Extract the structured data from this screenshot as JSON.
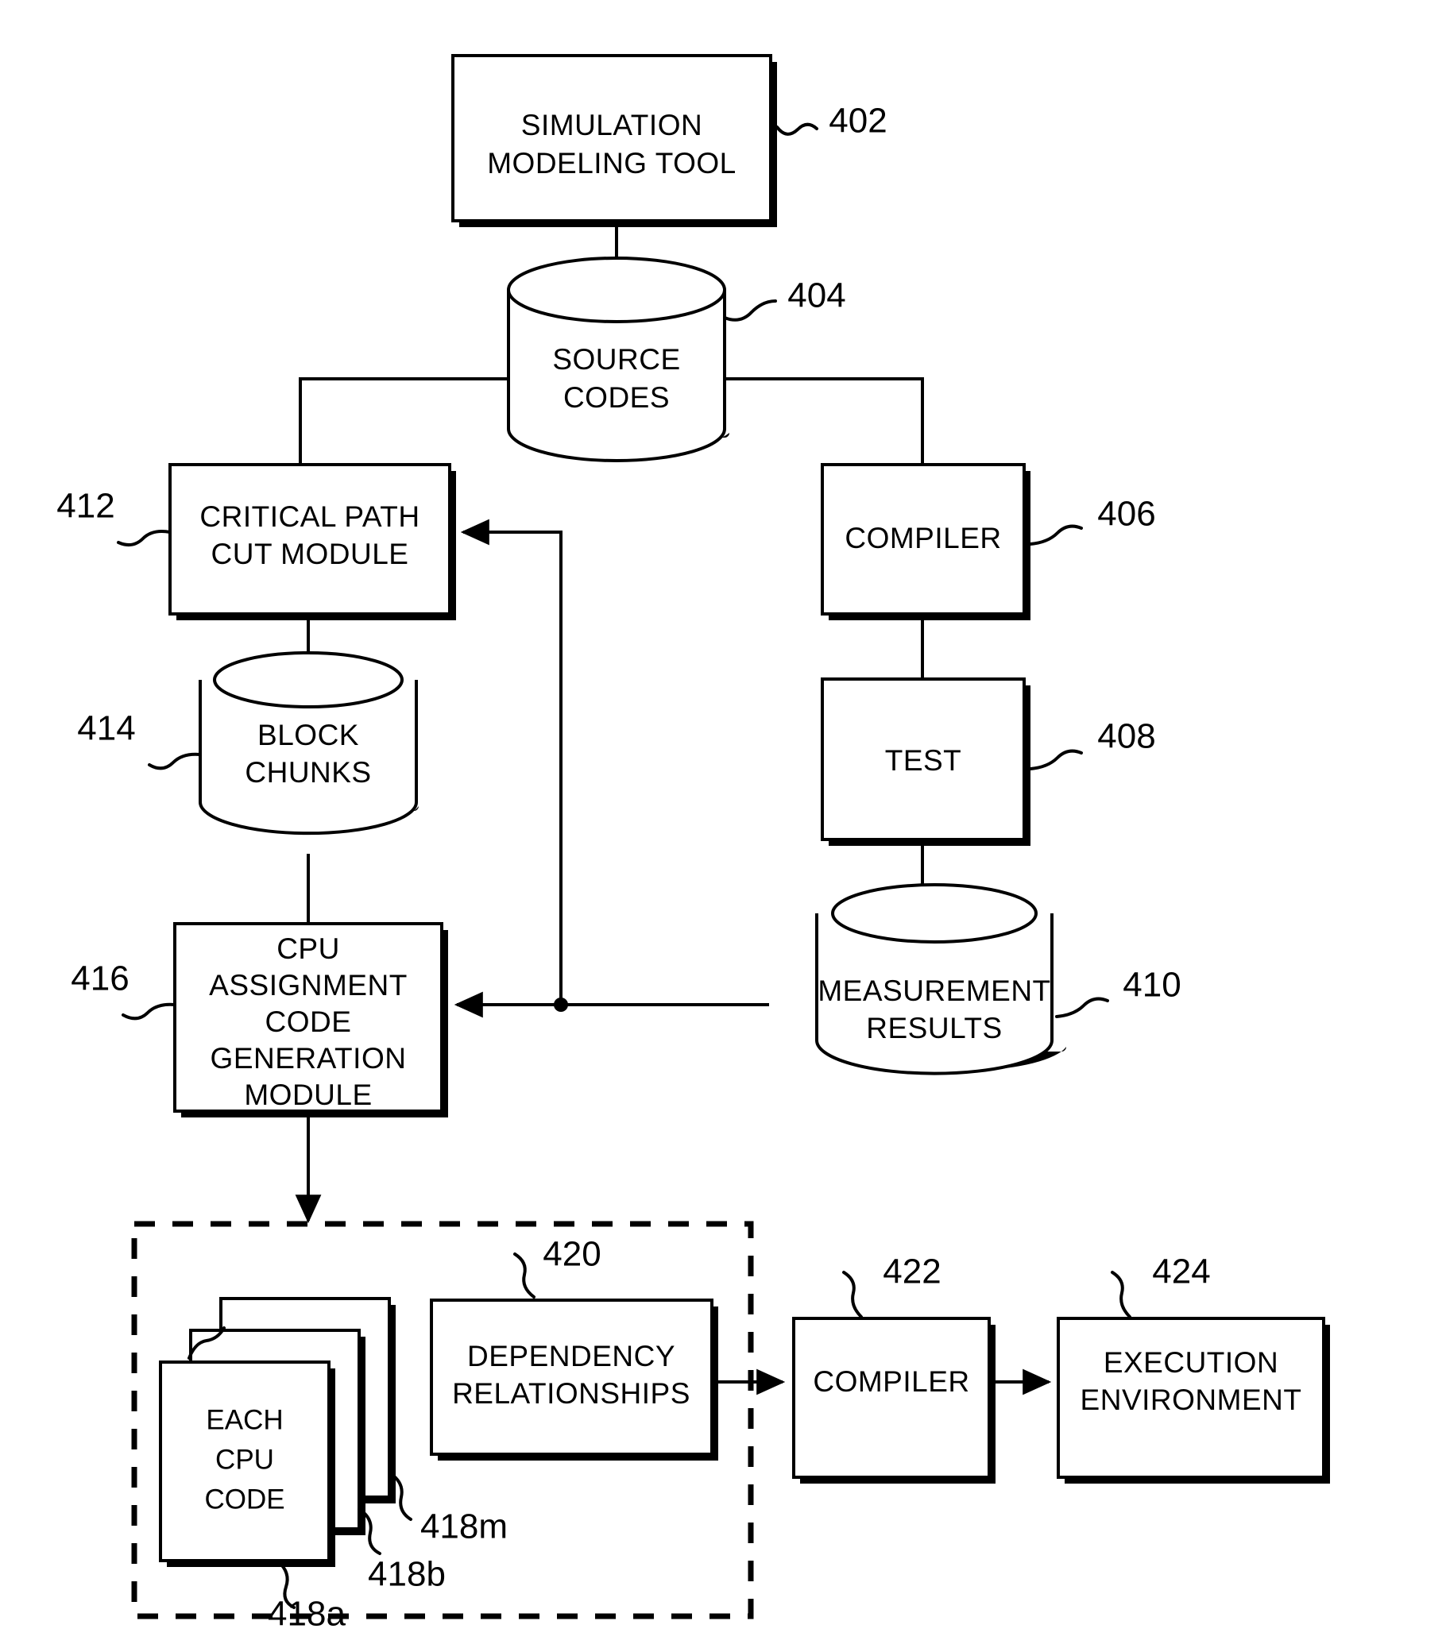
{
  "figure": {
    "type": "patent-block-diagram",
    "background_color": "#ffffff",
    "line_color": "#000000"
  },
  "nodes": {
    "simulation_modeling_tool": {
      "label_line1": "SIMULATION",
      "label_line2": "MODELING TOOL",
      "ref": "402",
      "shape": "rectangle"
    },
    "source_codes": {
      "label_line1": "SOURCE",
      "label_line2": "CODES",
      "ref": "404",
      "shape": "cylinder"
    },
    "critical_path_cut_module": {
      "label_line1": "CRITICAL PATH",
      "label_line2": "CUT MODULE",
      "ref": "412",
      "shape": "rectangle"
    },
    "block_chunks": {
      "label_line1": "BLOCK",
      "label_line2": "CHUNKS",
      "ref": "414",
      "shape": "cylinder"
    },
    "cpu_assignment_code_generation_module": {
      "label_line1": "CPU",
      "label_line2": "ASSIGNMENT",
      "label_line3": "CODE",
      "label_line4": "GENERATION",
      "label_line5": "MODULE",
      "ref": "416",
      "shape": "rectangle"
    },
    "compiler_upper": {
      "label_line1": "COMPILER",
      "ref": "406",
      "shape": "rectangle"
    },
    "test": {
      "label_line1": "TEST",
      "ref": "408",
      "shape": "rectangle"
    },
    "measurement_results": {
      "label_line1": "MEASUREMENT",
      "label_line2": "RESULTS",
      "ref": "410",
      "shape": "cylinder"
    },
    "each_cpu_code": {
      "label_line1": "EACH",
      "label_line2": "CPU",
      "label_line3": "CODE",
      "ref_front": "418a",
      "ref_middle": "418b",
      "ref_back": "418m",
      "shape": "stacked-pages"
    },
    "dependency_relationships": {
      "label_line1": "DEPENDENCY",
      "label_line2": "RELATIONSHIPS",
      "ref": "420",
      "shape": "rectangle"
    },
    "compiler_lower": {
      "label_line1": "COMPILER",
      "ref": "422",
      "shape": "rectangle"
    },
    "execution_environment": {
      "label_line1": "EXECUTION",
      "label_line2": "ENVIRONMENT",
      "ref": "424",
      "shape": "rectangle"
    }
  },
  "group_box": {
    "style": "dashed",
    "contains": [
      "each_cpu_code",
      "dependency_relationships"
    ]
  }
}
